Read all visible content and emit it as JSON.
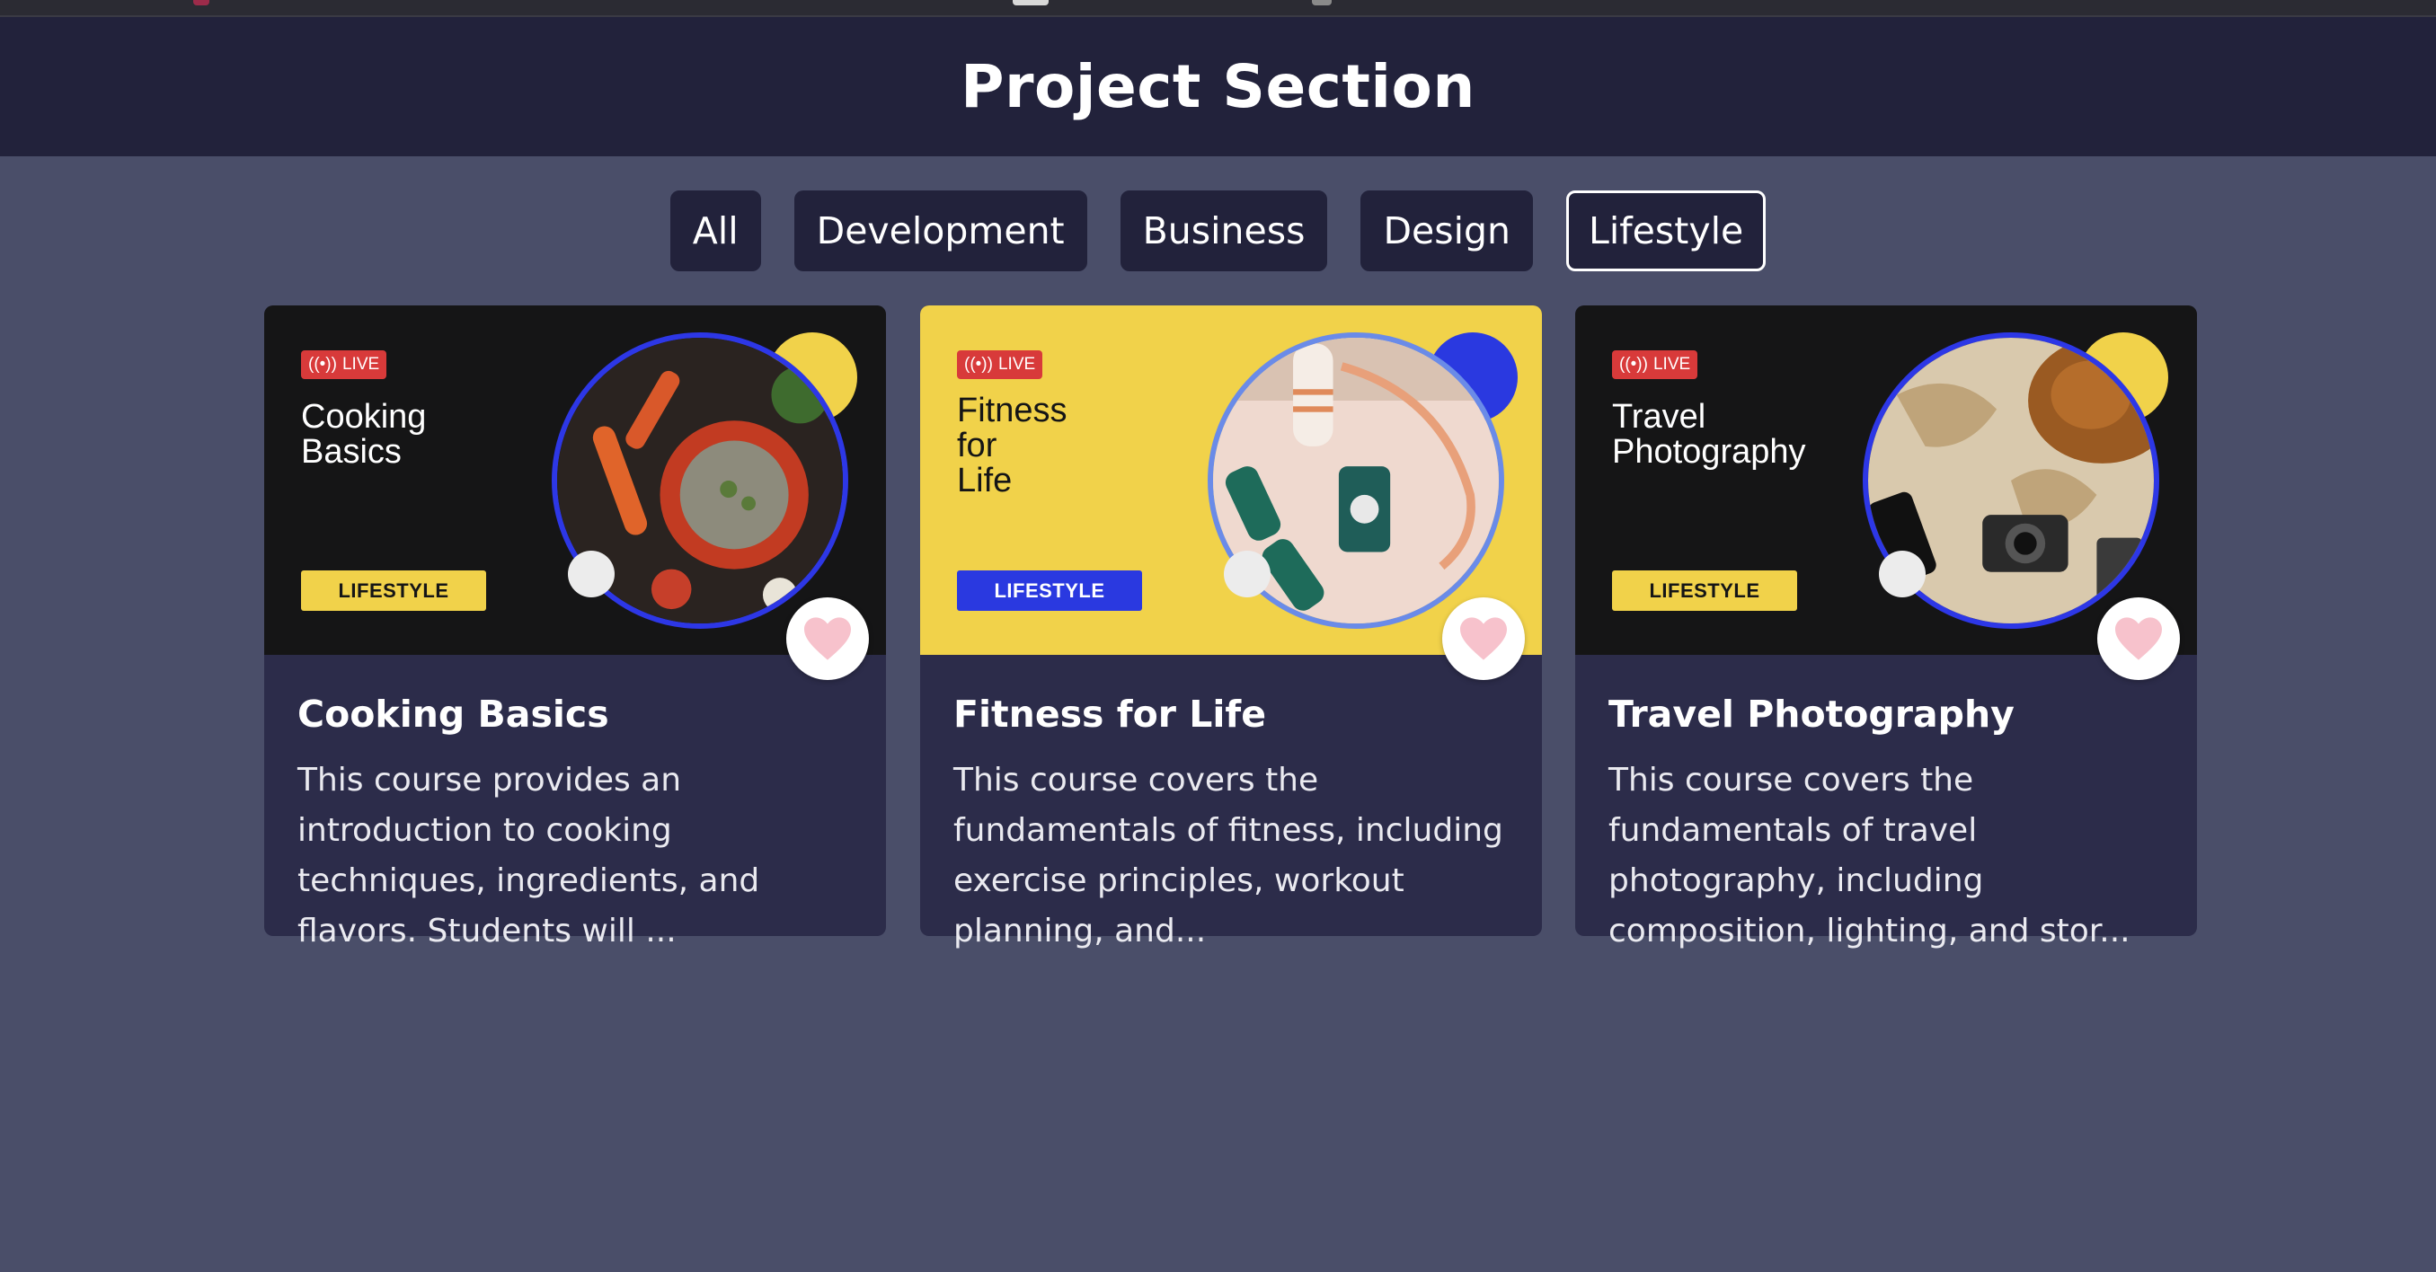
{
  "header": {
    "title": "Project Section"
  },
  "filters": {
    "all": "All",
    "development": "Development",
    "business": "Business",
    "design": "Design",
    "lifestyle": "Lifestyle",
    "active": "Lifestyle"
  },
  "cards": [
    {
      "live_label": "LIVE",
      "thumb_title": "Cooking\nBasics",
      "tag": "LIFESTYLE",
      "title": "Cooking Basics",
      "description": "This course provides an introduction to cooking techniques, ingredients, and flavors. Students will ...",
      "favorite_icon": "heart-icon"
    },
    {
      "live_label": "LIVE",
      "thumb_title": "Fitness\nfor\nLife",
      "tag": "LIFESTYLE",
      "title": "Fitness for Life",
      "description": "This course covers the fundamentals of fitness, including exercise principles, workout planning, and...",
      "favorite_icon": "heart-icon"
    },
    {
      "live_label": "LIVE",
      "thumb_title": "Travel\nPhotography",
      "tag": "LIFESTYLE",
      "title": "Travel Photography",
      "description": "This course covers the fundamentals of travel photography, including composition, lighting, and stor...",
      "favorite_icon": "heart-icon"
    }
  ],
  "colors": {
    "page_bg": "#4a4e69",
    "header_bg": "#22223b",
    "card_bg": "#2c2c4a",
    "accent_yellow": "#f1d24a",
    "accent_blue": "#2a39e0",
    "live_red": "#d83a3a",
    "heart_pink": "#f7c2cc"
  }
}
